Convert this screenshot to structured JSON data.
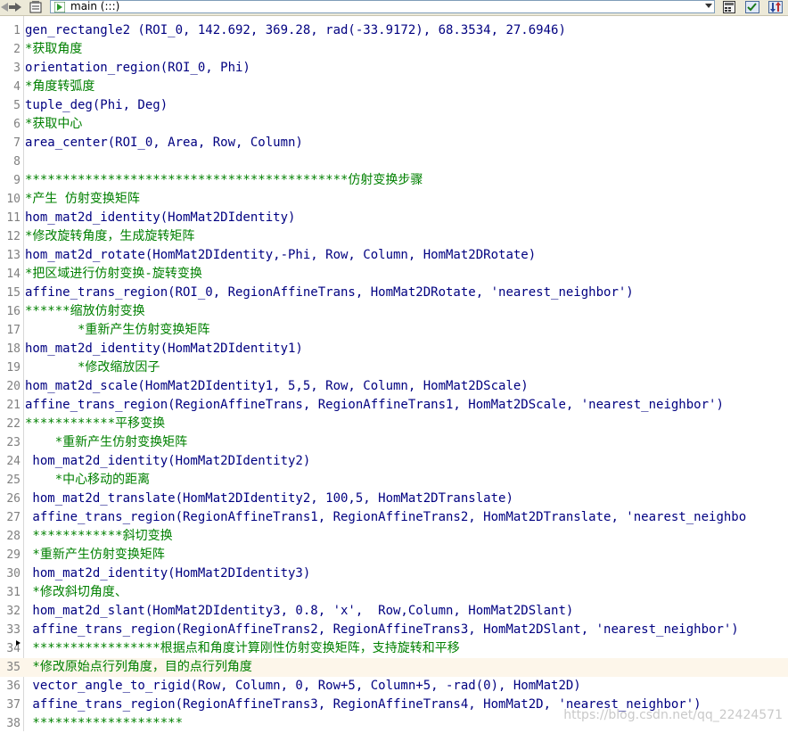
{
  "toolbar": {
    "procedure_name": "main (:::)"
  },
  "watermark": "https://blog.csdn.net/qq_22424571",
  "lines": [
    {
      "n": "1",
      "text": "gen_rectangle2 (ROI_0, 142.692, 369.28, rad(-33.9172), 68.3534, 27.6946)",
      "type": "code"
    },
    {
      "n": "2",
      "text": "*获取角度",
      "type": "comment"
    },
    {
      "n": "3",
      "text": "orientation_region(ROI_0, Phi)",
      "type": "code"
    },
    {
      "n": "4",
      "text": "*角度转弧度",
      "type": "comment"
    },
    {
      "n": "5",
      "text": "tuple_deg(Phi, Deg)",
      "type": "code"
    },
    {
      "n": "6",
      "text": "*获取中心",
      "type": "comment"
    },
    {
      "n": "7",
      "text": "area_center(ROI_0, Area, Row, Column)",
      "type": "code"
    },
    {
      "n": "8",
      "text": "",
      "type": "code"
    },
    {
      "n": "9",
      "text": "*******************************************仿射变换步骤",
      "type": "comment"
    },
    {
      "n": "10",
      "text": "*产生 仿射变换矩阵",
      "type": "comment"
    },
    {
      "n": "11",
      "text": "hom_mat2d_identity(HomMat2DIdentity)",
      "type": "code"
    },
    {
      "n": "12",
      "text": "*修改旋转角度，生成旋转矩阵",
      "type": "comment"
    },
    {
      "n": "13",
      "text": "hom_mat2d_rotate(HomMat2DIdentity,-Phi, Row, Column, HomMat2DRotate)",
      "type": "code"
    },
    {
      "n": "14",
      "text": "*把区域进行仿射变换-旋转变换",
      "type": "comment"
    },
    {
      "n": "15",
      "text": "affine_trans_region(ROI_0, RegionAffineTrans, HomMat2DRotate, 'nearest_neighbor')",
      "type": "code"
    },
    {
      "n": "16",
      "text": "******缩放仿射变换",
      "type": "comment"
    },
    {
      "n": "17",
      "text": "       *重新产生仿射变换矩阵",
      "type": "comment"
    },
    {
      "n": "18",
      "text": "hom_mat2d_identity(HomMat2DIdentity1)",
      "type": "code"
    },
    {
      "n": "19",
      "text": "       *修改缩放因子",
      "type": "comment"
    },
    {
      "n": "20",
      "text": "hom_mat2d_scale(HomMat2DIdentity1, 5,5, Row, Column, HomMat2DScale)",
      "type": "code"
    },
    {
      "n": "21",
      "text": "affine_trans_region(RegionAffineTrans, RegionAffineTrans1, HomMat2DScale, 'nearest_neighbor')",
      "type": "code"
    },
    {
      "n": "22",
      "text": "************平移变换",
      "type": "comment"
    },
    {
      "n": "23",
      "text": "    *重新产生仿射变换矩阵",
      "type": "comment"
    },
    {
      "n": "24",
      "text": " hom_mat2d_identity(HomMat2DIdentity2)",
      "type": "code"
    },
    {
      "n": "25",
      "text": "    *中心移动的距离",
      "type": "comment"
    },
    {
      "n": "26",
      "text": " hom_mat2d_translate(HomMat2DIdentity2, 100,5, HomMat2DTranslate)",
      "type": "code"
    },
    {
      "n": "27",
      "text": " affine_trans_region(RegionAffineTrans1, RegionAffineTrans2, HomMat2DTranslate, 'nearest_neighbo",
      "type": "code"
    },
    {
      "n": "28",
      "text": " ************斜切变换",
      "type": "comment"
    },
    {
      "n": "29",
      "text": " *重新产生仿射变换矩阵",
      "type": "comment"
    },
    {
      "n": "30",
      "text": " hom_mat2d_identity(HomMat2DIdentity3)",
      "type": "code"
    },
    {
      "n": "31",
      "text": " *修改斜切角度、",
      "type": "comment"
    },
    {
      "n": "32",
      "text": " hom_mat2d_slant(HomMat2DIdentity3, 0.8, 'x',  Row,Column, HomMat2DSlant)",
      "type": "code"
    },
    {
      "n": "33",
      "text": " affine_trans_region(RegionAffineTrans2, RegionAffineTrans3, HomMat2DSlant, 'nearest_neighbor')",
      "type": "code"
    },
    {
      "n": "34",
      "text": " *****************根据点和角度计算刚性仿射变换矩阵，支持旋转和平移",
      "type": "comment"
    },
    {
      "n": "35",
      "text": " *修改原始点行列角度，目的点行列角度",
      "type": "comment",
      "highlight": true
    },
    {
      "n": "36",
      "text": " vector_angle_to_rigid(Row, Column, 0, Row+5, Column+5, -rad(0), HomMat2D)",
      "type": "code"
    },
    {
      "n": "37",
      "text": " affine_trans_region(RegionAffineTrans3, RegionAffineTrans4, HomMat2D, 'nearest_neighbor')",
      "type": "code"
    },
    {
      "n": "38",
      "text": " ********************",
      "type": "comment"
    }
  ]
}
